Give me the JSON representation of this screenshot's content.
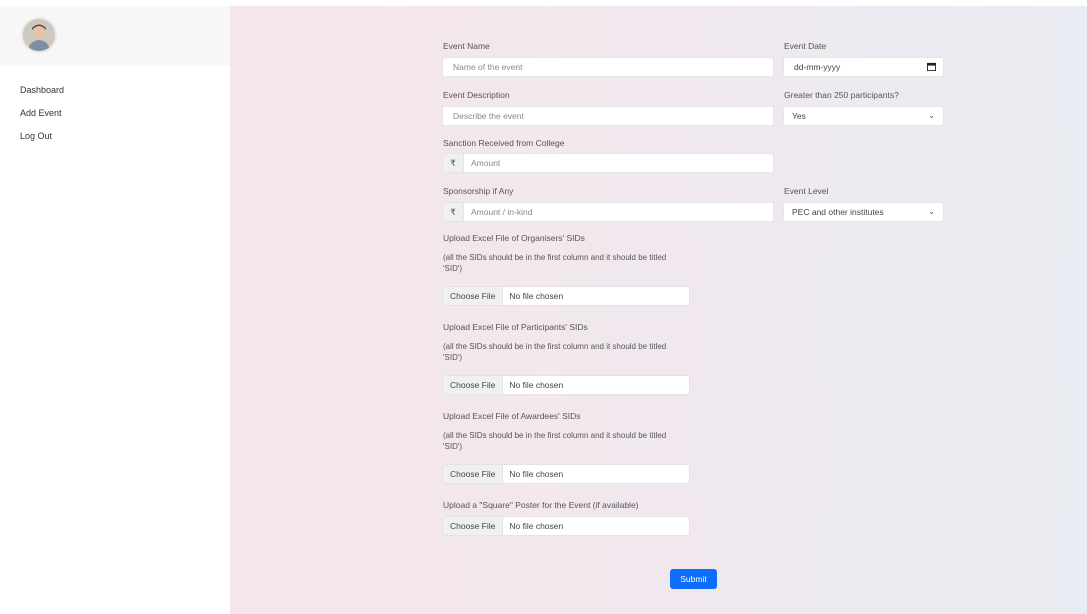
{
  "sidebar": {
    "items": [
      {
        "label": "Dashboard"
      },
      {
        "label": "Add Event"
      },
      {
        "label": "Log Out"
      }
    ]
  },
  "form": {
    "event_name": {
      "label": "Event Name",
      "placeholder": "Name of the event"
    },
    "event_date": {
      "label": "Event Date",
      "placeholder": "dd-mm-yyyy"
    },
    "event_description": {
      "label": "Event Description",
      "placeholder": "Describe the event"
    },
    "participants": {
      "label": "Greater than 250 participants?",
      "value": "Yes"
    },
    "sanction": {
      "label": "Sanction Received from College",
      "prefix": "₹",
      "placeholder": "Amount"
    },
    "sponsorship": {
      "label": "Sponsorship if Any",
      "prefix": "₹",
      "placeholder": "Amount / in-kind"
    },
    "event_level": {
      "label": "Event Level",
      "value": "PEC and other institutes"
    },
    "organisers": {
      "label": "Upload Excel File of Organisers' SIDs",
      "hint": "(all the SIDs should be in the first column and it should be titled 'SID')",
      "button": "Choose File",
      "status": "No file chosen"
    },
    "participants_file": {
      "label": "Upload Excel File of Participants' SIDs",
      "hint": "(all the SIDs should be in the first column and it should be titled 'SID')",
      "button": "Choose File",
      "status": "No file chosen"
    },
    "awardees": {
      "label": "Upload Excel File of Awardees' SIDs",
      "hint": "(all the SIDs should be in the first column and it should be titled 'SID')",
      "button": "Choose File",
      "status": "No file chosen"
    },
    "poster": {
      "label": "Upload a \"Square\" Poster for the Event (if available)",
      "button": "Choose File",
      "status": "No file chosen"
    },
    "submit_label": "Submit"
  },
  "colors": {
    "accent": "#0d6efd"
  }
}
